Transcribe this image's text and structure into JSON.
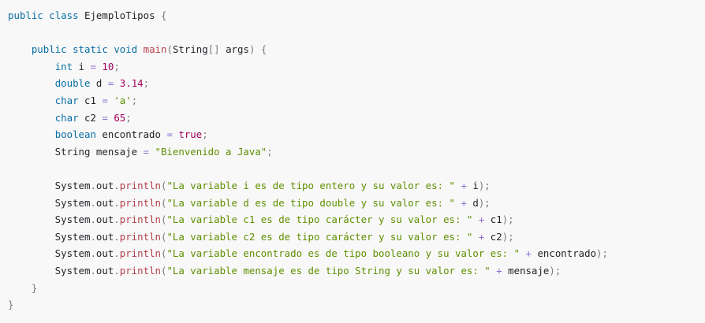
{
  "code": {
    "language": "java",
    "lines": [
      [
        {
          "t": "public",
          "c": "kw"
        },
        {
          "t": " "
        },
        {
          "t": "class",
          "c": "kw"
        },
        {
          "t": " EjemploTipos "
        },
        {
          "t": "{",
          "c": "pun"
        }
      ],
      [],
      [
        {
          "t": "    "
        },
        {
          "t": "public",
          "c": "kw"
        },
        {
          "t": " "
        },
        {
          "t": "static",
          "c": "kw"
        },
        {
          "t": " "
        },
        {
          "t": "void",
          "c": "kw"
        },
        {
          "t": " "
        },
        {
          "t": "main",
          "c": "fn"
        },
        {
          "t": "(",
          "c": "pun"
        },
        {
          "t": "String"
        },
        {
          "t": "[]",
          "c": "pun"
        },
        {
          "t": " args"
        },
        {
          "t": ")",
          "c": "pun"
        },
        {
          "t": " "
        },
        {
          "t": "{",
          "c": "pun"
        }
      ],
      [
        {
          "t": "        "
        },
        {
          "t": "int",
          "c": "kw"
        },
        {
          "t": " i "
        },
        {
          "t": "=",
          "c": "op"
        },
        {
          "t": " "
        },
        {
          "t": "10",
          "c": "num"
        },
        {
          "t": ";",
          "c": "pun"
        }
      ],
      [
        {
          "t": "        "
        },
        {
          "t": "double",
          "c": "kw"
        },
        {
          "t": " d "
        },
        {
          "t": "=",
          "c": "op"
        },
        {
          "t": " "
        },
        {
          "t": "3.14",
          "c": "num"
        },
        {
          "t": ";",
          "c": "pun"
        }
      ],
      [
        {
          "t": "        "
        },
        {
          "t": "char",
          "c": "kw"
        },
        {
          "t": " c1 "
        },
        {
          "t": "=",
          "c": "op"
        },
        {
          "t": " "
        },
        {
          "t": "'a'",
          "c": "str"
        },
        {
          "t": ";",
          "c": "pun"
        }
      ],
      [
        {
          "t": "        "
        },
        {
          "t": "char",
          "c": "kw"
        },
        {
          "t": " c2 "
        },
        {
          "t": "=",
          "c": "op"
        },
        {
          "t": " "
        },
        {
          "t": "65",
          "c": "num"
        },
        {
          "t": ";",
          "c": "pun"
        }
      ],
      [
        {
          "t": "        "
        },
        {
          "t": "boolean",
          "c": "kw"
        },
        {
          "t": " encontrado "
        },
        {
          "t": "=",
          "c": "op"
        },
        {
          "t": " "
        },
        {
          "t": "true",
          "c": "num"
        },
        {
          "t": ";",
          "c": "pun"
        }
      ],
      [
        {
          "t": "        String mensaje "
        },
        {
          "t": "=",
          "c": "op"
        },
        {
          "t": " "
        },
        {
          "t": "\"Bienvenido a Java\"",
          "c": "str"
        },
        {
          "t": ";",
          "c": "pun"
        }
      ],
      [],
      [
        {
          "t": "        System"
        },
        {
          "t": ".",
          "c": "pun"
        },
        {
          "t": "out"
        },
        {
          "t": ".",
          "c": "pun"
        },
        {
          "t": "println",
          "c": "fn"
        },
        {
          "t": "(",
          "c": "pun"
        },
        {
          "t": "\"La variable i es de tipo entero y su valor es: \"",
          "c": "str"
        },
        {
          "t": " "
        },
        {
          "t": "+",
          "c": "op"
        },
        {
          "t": " i"
        },
        {
          "t": ");",
          "c": "pun"
        }
      ],
      [
        {
          "t": "        System"
        },
        {
          "t": ".",
          "c": "pun"
        },
        {
          "t": "out"
        },
        {
          "t": ".",
          "c": "pun"
        },
        {
          "t": "println",
          "c": "fn"
        },
        {
          "t": "(",
          "c": "pun"
        },
        {
          "t": "\"La variable d es de tipo double y su valor es: \"",
          "c": "str"
        },
        {
          "t": " "
        },
        {
          "t": "+",
          "c": "op"
        },
        {
          "t": " d"
        },
        {
          "t": ");",
          "c": "pun"
        }
      ],
      [
        {
          "t": "        System"
        },
        {
          "t": ".",
          "c": "pun"
        },
        {
          "t": "out"
        },
        {
          "t": ".",
          "c": "pun"
        },
        {
          "t": "println",
          "c": "fn"
        },
        {
          "t": "(",
          "c": "pun"
        },
        {
          "t": "\"La variable c1 es de tipo carácter y su valor es: \"",
          "c": "str"
        },
        {
          "t": " "
        },
        {
          "t": "+",
          "c": "op"
        },
        {
          "t": " c1"
        },
        {
          "t": ");",
          "c": "pun"
        }
      ],
      [
        {
          "t": "        System"
        },
        {
          "t": ".",
          "c": "pun"
        },
        {
          "t": "out"
        },
        {
          "t": ".",
          "c": "pun"
        },
        {
          "t": "println",
          "c": "fn"
        },
        {
          "t": "(",
          "c": "pun"
        },
        {
          "t": "\"La variable c2 es de tipo carácter y su valor es: \"",
          "c": "str"
        },
        {
          "t": " "
        },
        {
          "t": "+",
          "c": "op"
        },
        {
          "t": " c2"
        },
        {
          "t": ");",
          "c": "pun"
        }
      ],
      [
        {
          "t": "        System"
        },
        {
          "t": ".",
          "c": "pun"
        },
        {
          "t": "out"
        },
        {
          "t": ".",
          "c": "pun"
        },
        {
          "t": "println",
          "c": "fn"
        },
        {
          "t": "(",
          "c": "pun"
        },
        {
          "t": "\"La variable encontrado es de tipo booleano y su valor es: \"",
          "c": "str"
        },
        {
          "t": " "
        },
        {
          "t": "+",
          "c": "op"
        },
        {
          "t": " encontrado"
        },
        {
          "t": ");",
          "c": "pun"
        }
      ],
      [
        {
          "t": "        System"
        },
        {
          "t": ".",
          "c": "pun"
        },
        {
          "t": "out"
        },
        {
          "t": ".",
          "c": "pun"
        },
        {
          "t": "println",
          "c": "fn"
        },
        {
          "t": "(",
          "c": "pun"
        },
        {
          "t": "\"La variable mensaje es de tipo String y su valor es: \"",
          "c": "str"
        },
        {
          "t": " "
        },
        {
          "t": "+",
          "c": "op"
        },
        {
          "t": " mensaje"
        },
        {
          "t": ");",
          "c": "pun"
        }
      ],
      [
        {
          "t": "    "
        },
        {
          "t": "}",
          "c": "pun"
        }
      ],
      [
        {
          "t": "}",
          "c": "pun"
        }
      ]
    ]
  },
  "colors": {
    "background": "#f8f8f8",
    "keyword": "#0b6ea5",
    "function": "#b23f4a",
    "number": "#a0005a",
    "string": "#5e8f00",
    "operator": "#8f6fd6",
    "punctuation": "#7a7a7a",
    "identifier": "#1f2328"
  }
}
